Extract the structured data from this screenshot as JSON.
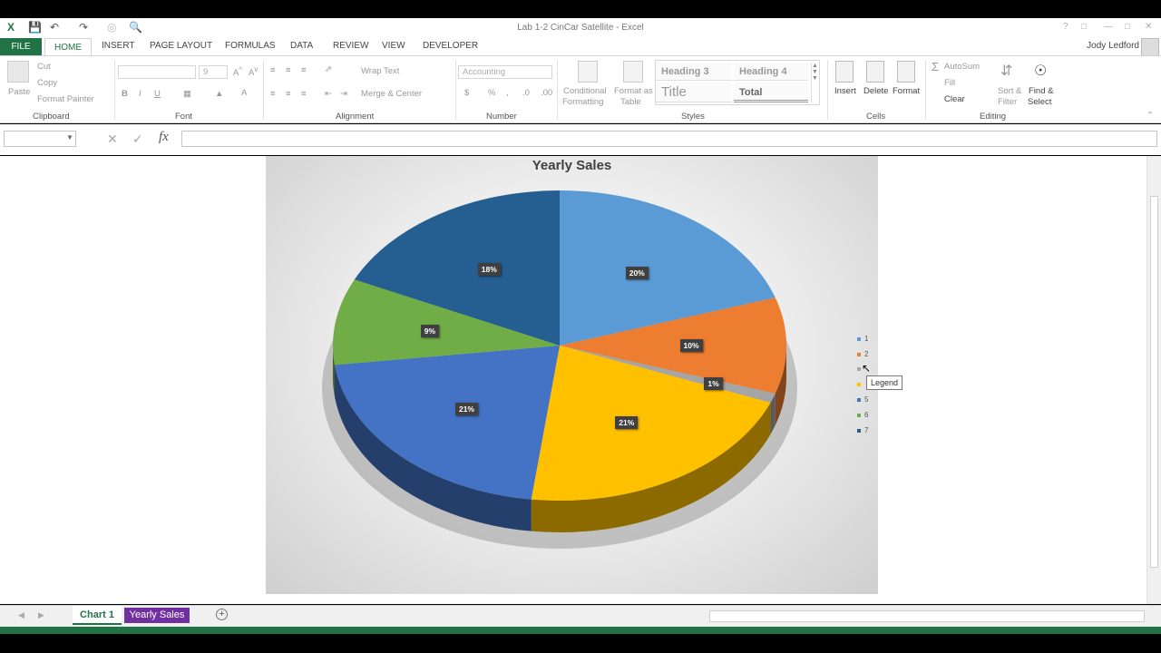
{
  "window": {
    "title": "Lab 1-2 CinCar Satellite - Excel",
    "user": "Jody Ledford"
  },
  "tabs": [
    "FILE",
    "HOME",
    "INSERT",
    "PAGE LAYOUT",
    "FORMULAS",
    "DATA",
    "REVIEW",
    "VIEW",
    "DEVELOPER"
  ],
  "ribbon": {
    "clipboard": {
      "paste": "Paste",
      "cut": "Cut",
      "copy": "Copy",
      "format_painter": "Format Painter",
      "label": "Clipboard"
    },
    "font": {
      "size": "9",
      "bold": "B",
      "italic": "I",
      "underline": "U",
      "label": "Font"
    },
    "alignment": {
      "wrap": "Wrap Text",
      "merge": "Merge & Center",
      "label": "Alignment"
    },
    "number": {
      "format": "Accounting",
      "label": "Number"
    },
    "styles": {
      "conditional_1": "Conditional",
      "conditional_2": "Formatting",
      "format_as_1": "Format as",
      "format_as_2": "Table",
      "heading3": "Heading 3",
      "heading4": "Heading 4",
      "title": "Title",
      "total": "Total",
      "label": "Styles"
    },
    "cells": {
      "insert": "Insert",
      "delete": "Delete",
      "format": "Format",
      "label": "Cells"
    },
    "editing": {
      "autosum": "AutoSum",
      "fill": "Fill",
      "clear": "Clear",
      "sort_1": "Sort &",
      "sort_2": "Filter",
      "find_1": "Find &",
      "find_2": "Select",
      "label": "Editing"
    }
  },
  "formula_bar": {
    "fx": "fx"
  },
  "chart_data": {
    "type": "pie",
    "title": "Yearly Sales",
    "categories": [
      "1",
      "2",
      "3",
      "4",
      "5",
      "6",
      "7"
    ],
    "values": [
      20,
      10,
      1,
      21,
      21,
      9,
      18
    ],
    "labels": [
      "20%",
      "10%",
      "1%",
      "21%",
      "21%",
      "9%",
      "18%"
    ],
    "colors": [
      "#5b9bd5",
      "#ed7d31",
      "#a5a5a5",
      "#ffc000",
      "#4472c4",
      "#70ad47",
      "#255e91"
    ],
    "legend_position": "right",
    "style": "3-D pie"
  },
  "legend_items": [
    {
      "label": "1",
      "color": "#5b9bd5"
    },
    {
      "label": "2",
      "color": "#ed7d31"
    },
    {
      "label": "",
      "color": "#a5a5a5"
    },
    {
      "label": "",
      "color": "#ffc000"
    },
    {
      "label": "5",
      "color": "#4472c4"
    },
    {
      "label": "6",
      "color": "#70ad47"
    },
    {
      "label": "7",
      "color": "#255e91"
    }
  ],
  "tooltip": "Legend",
  "sheets": {
    "chart1": "Chart 1",
    "yearly": "Yearly Sales"
  }
}
